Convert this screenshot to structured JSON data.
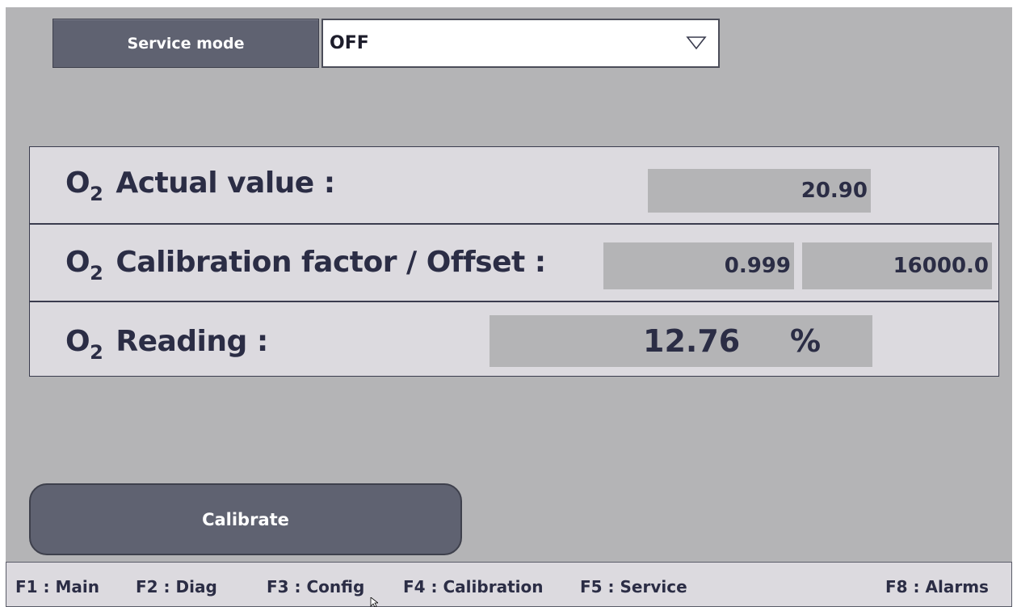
{
  "service": {
    "label": "Service mode",
    "mode_value": "OFF",
    "dropdown_icon": "triangle-down-icon"
  },
  "o2": {
    "symbol": "O",
    "subscript": "2",
    "actual_label": "Actual value :",
    "actual_value": "20.90",
    "calibration_label": "Calibration factor / Offset :",
    "calibration_factor": "0.999",
    "offset": "16000.0",
    "reading_label": "Reading :",
    "reading_value": "12.76",
    "reading_unit": "%"
  },
  "actions": {
    "calibrate_label": "Calibrate"
  },
  "fkeys": [
    "F1 : Main",
    "F2 : Diag",
    "F3 : Config",
    "F4 : Calibration",
    "F5 : Service",
    "F8 : Alarms"
  ],
  "colors": {
    "screen_bg": "#b4b4b6",
    "panel_bg": "#dcdadf",
    "button_bg": "#5f6271",
    "text_dark": "#2b2d45"
  }
}
